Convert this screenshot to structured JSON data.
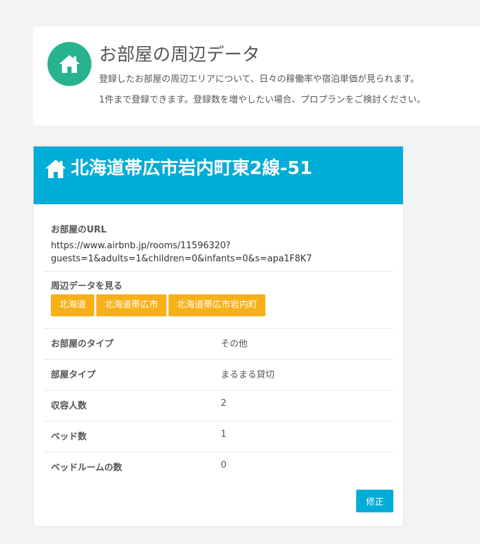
{
  "header": {
    "title": "お部屋の周辺データ",
    "desc_line1": "登録したお部屋の周辺エリアについて、日々の稼働率や宿泊単価が見られます。",
    "desc_line2": "1件まで登録できます。登録数を増やしたい場合、プロプランをご検討ください。",
    "icon": "home-icon",
    "icon_color": "#26b38e"
  },
  "room": {
    "title": "北海道帯広市岩内町東2線-51",
    "header_color": "#00acd8",
    "url_label": "お部屋のURL",
    "url_line1": "https://www.airbnb.jp/rooms/11596320?",
    "url_line2": "guests=1&adults=1&children=0&infants=0&s=apa1F8K7",
    "area_label": "周辺データを見る",
    "area_tags": [
      "北海道",
      "北海道帯広市",
      "北海道帯広市岩内町"
    ],
    "tag_color": "#f8b018",
    "details": [
      {
        "key": "お部屋のタイプ",
        "value": "その他"
      },
      {
        "key": "部屋タイプ",
        "value": "まるまる貸切"
      },
      {
        "key": "収容人数",
        "value": "2"
      },
      {
        "key": "ベッド数",
        "value": "1"
      },
      {
        "key": "ベッドルームの数",
        "value": "0"
      }
    ],
    "edit_label": "修正"
  }
}
